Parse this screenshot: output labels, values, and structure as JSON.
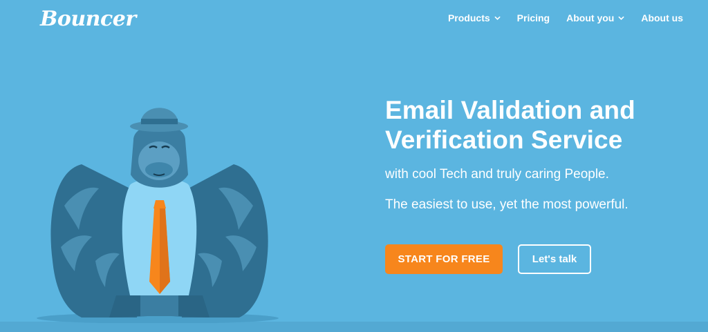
{
  "brand": {
    "logo_text": "Bouncer",
    "colors": {
      "background": "#5bb5e0",
      "cta_orange": "#f7861c",
      "text": "#ffffff"
    }
  },
  "nav": {
    "items": [
      {
        "label": "Products",
        "has_dropdown": true
      },
      {
        "label": "Pricing",
        "has_dropdown": false
      },
      {
        "label": "About you",
        "has_dropdown": true
      },
      {
        "label": "About us",
        "has_dropdown": false
      }
    ]
  },
  "hero": {
    "title_line1": "Email Validation and",
    "title_line2": "Verification Service",
    "subtitle": "with cool Tech and truly caring People.",
    "tagline": "The easiest to use, yet the most powerful.",
    "primary_cta": "START FOR FREE",
    "secondary_cta": "Let's talk",
    "illustration": "gorilla-mascot-with-hat-and-tie"
  }
}
